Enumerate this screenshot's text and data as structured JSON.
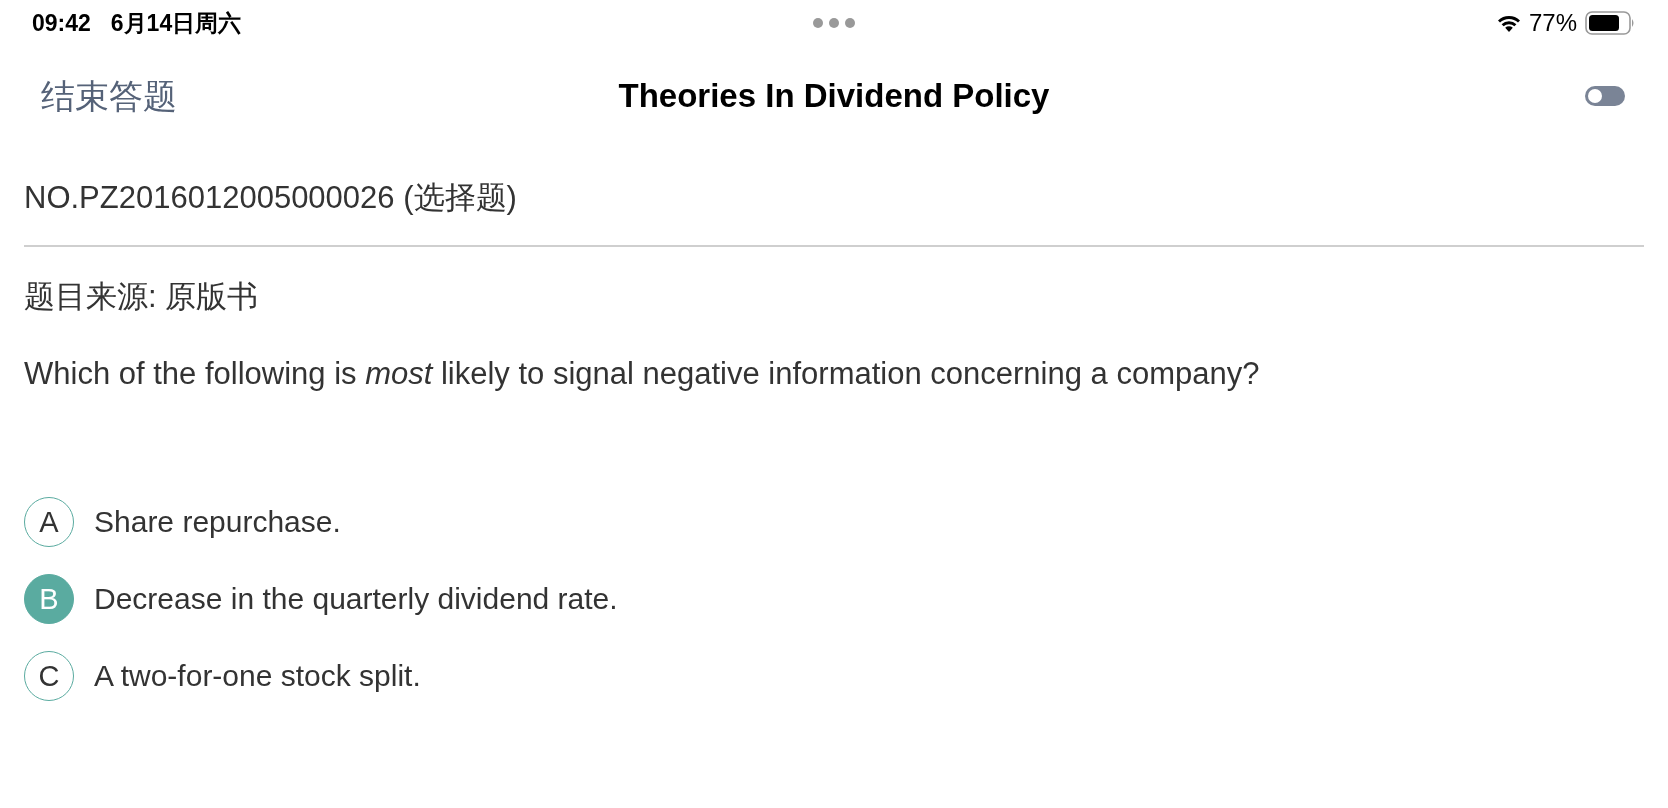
{
  "status_bar": {
    "time": "09:42",
    "date": "6月14日周六",
    "battery": "77%"
  },
  "nav_bar": {
    "back": "结束答题",
    "title": "Theories In Dividend Policy",
    "toggle": {
      "on": false
    }
  },
  "question": {
    "number": "NO.PZ2016012005000026 (选择题)",
    "source": "题目来源: 原版书",
    "text": "Which of the following is *most* likely to signal negative information concerning a company?"
  },
  "options": [
    {
      "letter": "A",
      "text": "Share repurchase.",
      "selected": false
    },
    {
      "letter": "B",
      "text": "Decrease in the quarterly dividend rate.",
      "selected": true
    },
    {
      "letter": "C",
      "text": "A two-for-one stock split.",
      "selected": false
    }
  ]
}
